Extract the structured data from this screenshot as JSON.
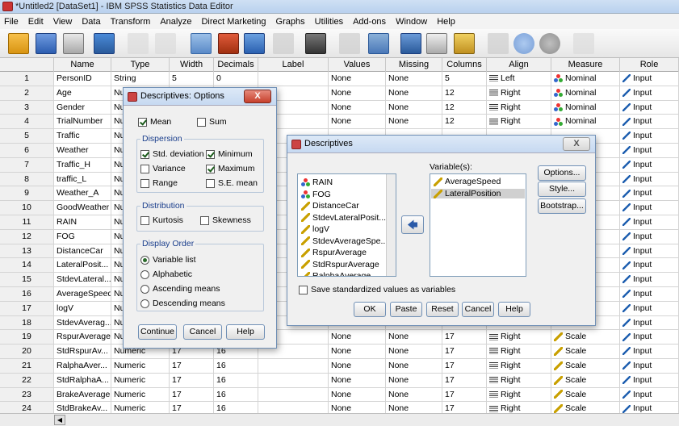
{
  "window": {
    "title": "*Untitled2 [DataSet1] - IBM SPSS Statistics Data Editor"
  },
  "menu": [
    "File",
    "Edit",
    "View",
    "Data",
    "Transform",
    "Analyze",
    "Direct Marketing",
    "Graphs",
    "Utilities",
    "Add-ons",
    "Window",
    "Help"
  ],
  "columns": [
    "",
    "Name",
    "Type",
    "Width",
    "Decimals",
    "Label",
    "Values",
    "Missing",
    "Columns",
    "Align",
    "Measure",
    "Role"
  ],
  "rows": [
    {
      "n": "1",
      "name": "PersonID",
      "type": "String",
      "width": "5",
      "dec": "0",
      "values": "None",
      "missing": "None",
      "cols": "5",
      "align": "Left",
      "measure": "Nominal",
      "role": "Input"
    },
    {
      "n": "2",
      "name": "Age",
      "type": "Nu",
      "width": "",
      "dec": "",
      "values": "None",
      "missing": "None",
      "cols": "12",
      "align": "Right",
      "measure": "Nominal",
      "role": "Input"
    },
    {
      "n": "3",
      "name": "Gender",
      "type": "Nu",
      "width": "",
      "dec": "",
      "values": "None",
      "missing": "None",
      "cols": "12",
      "align": "Right",
      "measure": "Nominal",
      "role": "Input"
    },
    {
      "n": "4",
      "name": "TrialNumber",
      "type": "Nu",
      "width": "",
      "dec": "",
      "values": "None",
      "missing": "None",
      "cols": "12",
      "align": "Right",
      "measure": "Nominal",
      "role": "Input"
    },
    {
      "n": "5",
      "name": "Traffic",
      "type": "Nu",
      "width": "",
      "dec": "",
      "values": "",
      "missing": "",
      "cols": "",
      "align": "",
      "measure": "",
      "role": "Input"
    },
    {
      "n": "6",
      "name": "Weather",
      "type": "Nu",
      "width": "",
      "dec": "",
      "values": "",
      "missing": "",
      "cols": "",
      "align": "",
      "measure": "",
      "role": "Input"
    },
    {
      "n": "7",
      "name": "Traffic_H",
      "type": "Nu",
      "width": "",
      "dec": "",
      "values": "",
      "missing": "",
      "cols": "",
      "align": "",
      "measure": "",
      "role": "Input"
    },
    {
      "n": "8",
      "name": "traffic_L",
      "type": "Nu",
      "width": "",
      "dec": "",
      "values": "",
      "missing": "",
      "cols": "",
      "align": "",
      "measure": "",
      "role": "Input"
    },
    {
      "n": "9",
      "name": "Weather_A",
      "type": "Nu",
      "width": "",
      "dec": "",
      "values": "",
      "missing": "",
      "cols": "",
      "align": "",
      "measure": "",
      "role": "Input"
    },
    {
      "n": "10",
      "name": "GoodWeather",
      "type": "Nu",
      "width": "",
      "dec": "",
      "values": "",
      "missing": "",
      "cols": "",
      "align": "",
      "measure": "",
      "role": "Input"
    },
    {
      "n": "11",
      "name": "RAIN",
      "type": "Nu",
      "width": "",
      "dec": "",
      "values": "",
      "missing": "",
      "cols": "",
      "align": "",
      "measure": "",
      "role": "Input"
    },
    {
      "n": "12",
      "name": "FOG",
      "type": "Nu",
      "width": "",
      "dec": "",
      "values": "",
      "missing": "",
      "cols": "",
      "align": "",
      "measure": "",
      "role": "Input"
    },
    {
      "n": "13",
      "name": "DistanceCar",
      "type": "Nu",
      "width": "",
      "dec": "",
      "values": "",
      "missing": "",
      "cols": "",
      "align": "",
      "measure": "",
      "role": "Input"
    },
    {
      "n": "14",
      "name": "LateralPosit...",
      "type": "Nu",
      "width": "",
      "dec": "",
      "values": "",
      "missing": "",
      "cols": "",
      "align": "",
      "measure": "",
      "role": "Input"
    },
    {
      "n": "15",
      "name": "StdevLateral...",
      "type": "Nu",
      "width": "",
      "dec": "",
      "values": "",
      "missing": "",
      "cols": "",
      "align": "",
      "measure": "",
      "role": "Input"
    },
    {
      "n": "16",
      "name": "AverageSpeed",
      "type": "Nu",
      "width": "",
      "dec": "",
      "values": "",
      "missing": "",
      "cols": "",
      "align": "",
      "measure": "",
      "role": "Input"
    },
    {
      "n": "17",
      "name": "logV",
      "type": "Nu",
      "width": "",
      "dec": "",
      "values": "",
      "missing": "",
      "cols": "",
      "align": "",
      "measure": "",
      "role": "Input"
    },
    {
      "n": "18",
      "name": "StdevAverag...",
      "type": "Nu",
      "width": "",
      "dec": "",
      "values": "",
      "missing": "",
      "cols": "",
      "align": "",
      "measure": "",
      "role": "Input"
    },
    {
      "n": "19",
      "name": "RspurAverage",
      "type": "Nu",
      "width": "",
      "dec": "",
      "values": "None",
      "missing": "None",
      "cols": "17",
      "align": "Right",
      "measure": "Scale",
      "role": "Input"
    },
    {
      "n": "20",
      "name": "StdRspurAv...",
      "type": "Numeric",
      "width": "17",
      "dec": "16",
      "values": "None",
      "missing": "None",
      "cols": "17",
      "align": "Right",
      "measure": "Scale",
      "role": "Input"
    },
    {
      "n": "21",
      "name": "RalphaAver...",
      "type": "Numeric",
      "width": "17",
      "dec": "16",
      "values": "None",
      "missing": "None",
      "cols": "17",
      "align": "Right",
      "measure": "Scale",
      "role": "Input"
    },
    {
      "n": "22",
      "name": "StdRalphaA...",
      "type": "Numeric",
      "width": "17",
      "dec": "16",
      "values": "None",
      "missing": "None",
      "cols": "17",
      "align": "Right",
      "measure": "Scale",
      "role": "Input"
    },
    {
      "n": "23",
      "name": "BrakeAverage",
      "type": "Numeric",
      "width": "17",
      "dec": "16",
      "values": "None",
      "missing": "None",
      "cols": "17",
      "align": "Right",
      "measure": "Scale",
      "role": "Input"
    },
    {
      "n": "24",
      "name": "StdBrakeAv...",
      "type": "Numeric",
      "width": "17",
      "dec": "16",
      "values": "None",
      "missing": "None",
      "cols": "17",
      "align": "Right",
      "measure": "Scale",
      "role": "Input"
    }
  ],
  "options_dialog": {
    "title": "Descriptives: Options",
    "close": "X",
    "mean": "Mean",
    "sum": "Sum",
    "dispersion": "Dispersion",
    "std": "Std. deviation",
    "minimum": "Minimum",
    "variance": "Variance",
    "maximum": "Maximum",
    "range": "Range",
    "se": "S.E. mean",
    "distribution": "Distribution",
    "kurtosis": "Kurtosis",
    "skewness": "Skewness",
    "display_order": "Display Order",
    "order": [
      "Variable list",
      "Alphabetic",
      "Ascending means",
      "Descending means"
    ],
    "continue": "Continue",
    "cancel": "Cancel",
    "help": "Help"
  },
  "desc_dialog": {
    "title": "Descriptives",
    "close": "X",
    "source": [
      "RAIN",
      "FOG",
      "DistanceCar",
      "StdevLateralPosit...",
      "logV",
      "StdevAverageSpe...",
      "RspurAverage",
      "StdRspurAverage",
      "RalphaAverage"
    ],
    "variables_label": "Variable(s):",
    "variables": [
      "AverageSpeed",
      "LateralPosition"
    ],
    "options": "Options...",
    "style": "Style...",
    "bootstrap": "Bootstrap...",
    "save_std": "Save standardized values as variables",
    "ok": "OK",
    "paste": "Paste",
    "reset": "Reset",
    "cancel": "Cancel",
    "help": "Help"
  }
}
